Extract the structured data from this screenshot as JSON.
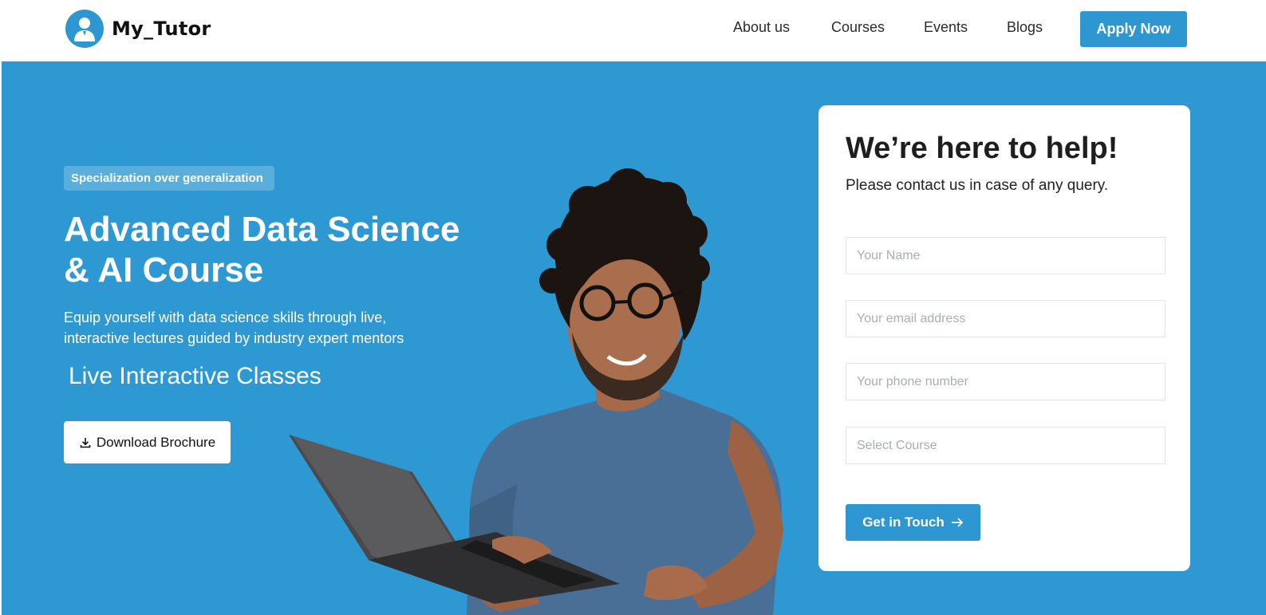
{
  "header": {
    "brand": "My_Tutor",
    "nav": [
      "About us",
      "Courses",
      "Events",
      "Blogs"
    ],
    "apply_label": "Apply Now"
  },
  "hero": {
    "badge": "Specialization over generalization",
    "title_line1": "Advanced Data Science",
    "title_line2": "& AI Course",
    "description_line1": "Equip yourself with data science skills through live,",
    "description_line2": "interactive lectures guided by industry expert mentors",
    "live_text": "Live Interactive Classes",
    "brochure_label": "Download Brochure",
    "image_icon": "student-with-laptop-image"
  },
  "contact": {
    "title": "We’re here to help!",
    "subtitle": "Please contact us in case of any query.",
    "name_placeholder": "Your Name",
    "email_placeholder": "Your email address",
    "phone_placeholder": "Your phone number",
    "course_placeholder": "Select Course",
    "submit_label": "Get in Touch"
  },
  "colors": {
    "primary": "#2e97d1",
    "hero_bg": "#2e98d2",
    "badge_bg": "#5aaedb",
    "white": "#ffffff"
  }
}
